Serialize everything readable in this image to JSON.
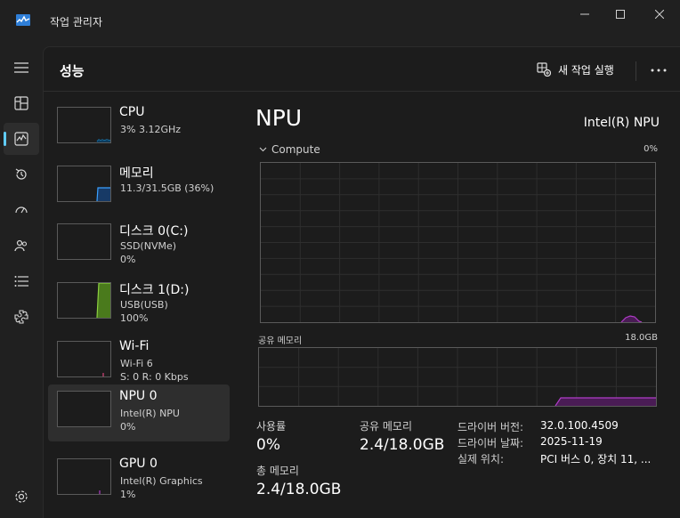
{
  "window": {
    "title": "작업 관리자"
  },
  "nav": {
    "items": [
      {
        "name": "menu-icon"
      },
      {
        "name": "processes-icon"
      },
      {
        "name": "performance-icon"
      },
      {
        "name": "app-history-icon"
      },
      {
        "name": "startup-apps-icon"
      },
      {
        "name": "users-icon"
      },
      {
        "name": "details-icon"
      },
      {
        "name": "services-icon"
      }
    ],
    "settings": "settings-icon"
  },
  "header": {
    "title": "성능",
    "run_task_label": "새 작업 실행"
  },
  "devices": [
    {
      "name": "CPU",
      "line1": "3%  3.12GHz",
      "line2": ""
    },
    {
      "name": "메모리",
      "line1": "11.3/31.5GB (36%)",
      "line2": ""
    },
    {
      "name": "디스크 0(C:)",
      "line1": "SSD(NVMe)",
      "line2": "0%"
    },
    {
      "name": "디스크 1(D:)",
      "line1": "USB(USB)",
      "line2": "100%"
    },
    {
      "name": "Wi-Fi",
      "line1": "Wi-Fi 6",
      "line2": "S: 0  R: 0 Kbps"
    },
    {
      "name": "NPU 0",
      "line1": "Intel(R) NPU",
      "line2": "0%"
    },
    {
      "name": "GPU 0",
      "line1": "Intel(R) Graphics",
      "line2": "1%"
    }
  ],
  "detail": {
    "title": "NPU",
    "model": "Intel(R) NPU",
    "compute_label": "Compute",
    "compute_pct": "0%",
    "shared_label": "공유 메모리",
    "shared_max": "18.0GB",
    "stats": {
      "usage_label": "사용률",
      "usage_value": "0%",
      "shared_mem_label": "공유 메모리",
      "shared_mem_value": "2.4/18.0GB",
      "total_mem_label": "총 메모리",
      "total_mem_value": "2.4/18.0GB"
    },
    "props": [
      {
        "label": "드라이버 버전:",
        "value": "32.0.100.4509"
      },
      {
        "label": "드라이버 날짜:",
        "value": "2025-11-19"
      },
      {
        "label": "실제 위치:",
        "value": "PCI 버스 0, 장치 11, ..."
      }
    ]
  },
  "colors": {
    "accent": "#60cdff",
    "cpu_line": "#1a8dd1",
    "memory_line": "#3aa0ff",
    "disk_fill": "#6aa62a",
    "wifi_line": "#d8467a",
    "npu_line": "#b03cc8",
    "gpu_line": "#b03cc8"
  }
}
